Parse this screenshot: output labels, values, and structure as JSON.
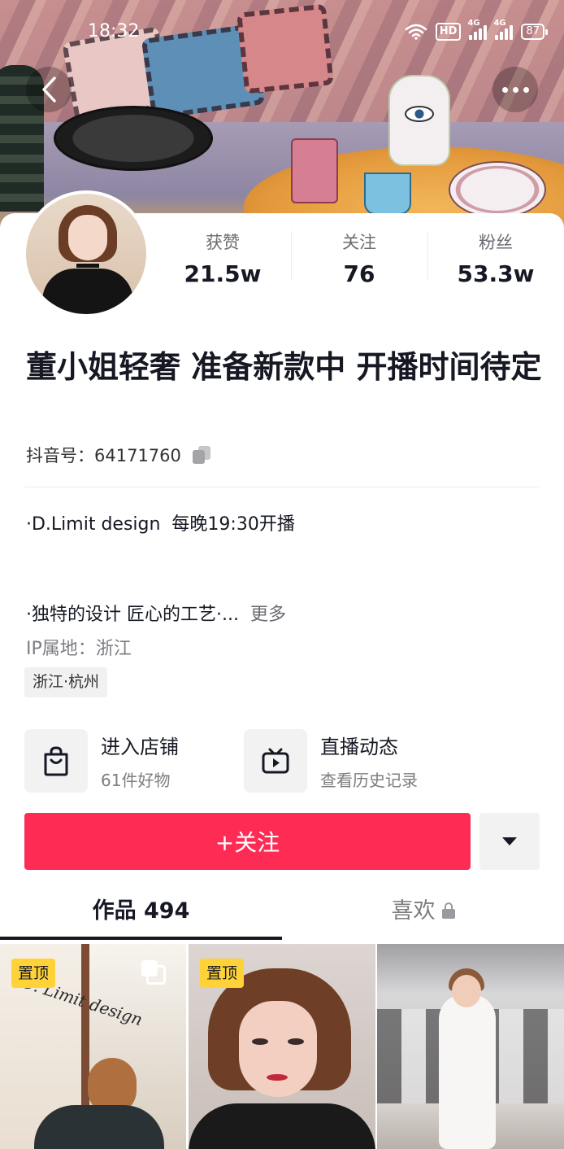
{
  "status_bar": {
    "time": "18:32",
    "hd_badge": "HD",
    "signal1_label": "4G",
    "signal2_label": "4G",
    "battery": "87"
  },
  "profile": {
    "stats": [
      {
        "label": "获赞",
        "value": "21.5w"
      },
      {
        "label": "关注",
        "value": "76"
      },
      {
        "label": "粉丝",
        "value": "53.3w"
      }
    ],
    "nickname": "董小姐轻奢 准备新款中 开播时间待定",
    "douyin_id": "抖音号：64171760",
    "bio_line1": "·D.Limit design  每晚19:30开播",
    "bio_line2": "·独特的设计 匠心的工艺·...",
    "bio_more": "更多",
    "ip_location": "IP属地：浙江",
    "tag": "浙江·杭州"
  },
  "entries": {
    "shop": {
      "title": "进入店铺",
      "subtitle": "61件好物",
      "icon": "shopping-bag-icon"
    },
    "live": {
      "title": "直播动态",
      "subtitle": "查看历史记录",
      "icon": "tv-play-icon"
    }
  },
  "actions": {
    "follow_label": "+关注",
    "dropdown_icon": "triangle-down-icon"
  },
  "tabs": {
    "works": "作品 494",
    "likes": "喜欢"
  },
  "grid": {
    "items": [
      {
        "pinned_label": "置顶",
        "overlay_text": "D. Limit design",
        "multi_image": true
      },
      {
        "pinned_label": "置顶"
      },
      {}
    ]
  },
  "colors": {
    "accent": "#fe2c55",
    "pin_badge": "#ffd338",
    "text_primary": "#161823",
    "text_secondary": "#7d7d82"
  }
}
